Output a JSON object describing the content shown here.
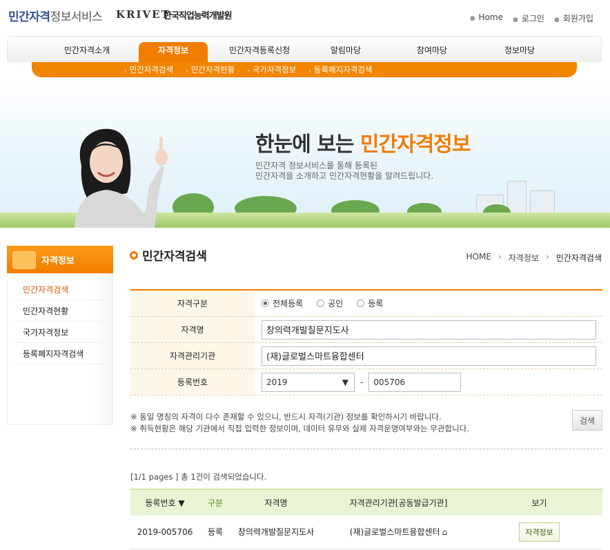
{
  "header": {
    "site_title_a": "민간자격",
    "site_title_b": "정보서비스",
    "org_logo": "KRIVET",
    "org_name": "한국직업능력개발원",
    "util_links": [
      "Home",
      "로그인",
      "회원가입"
    ]
  },
  "gnb": {
    "items": [
      "민간자격소개",
      "자격정보",
      "민간자격등록신청",
      "알림마당",
      "참여마당",
      "정보마당"
    ],
    "active_index": 1
  },
  "lnb": {
    "items": [
      "민간자격검색",
      "민간자격현황",
      "국가자격정보",
      "등록폐지자격검색"
    ]
  },
  "banner": {
    "title_plain": "한눈에 보는",
    "title_highlight": "민간자격정보",
    "desc_line1": "민간자격 정보서비스를 통해 등록된",
    "desc_line2": "민간자격을 소개하고 민간자격현황을 알려드립니다."
  },
  "sidebar": {
    "title": "자격정보",
    "items": [
      "민간자격검색",
      "민간자격현황",
      "국가자격정보",
      "등록폐지자격검색"
    ],
    "active_index": 0
  },
  "page": {
    "title": "민간자격검색",
    "breadcrumb": [
      "HOME",
      "자격정보",
      "민간자격검색"
    ]
  },
  "form": {
    "type_label": "자격구분",
    "type_options": [
      "전체등록",
      "공인",
      "등록"
    ],
    "type_selected": "전체등록",
    "name_label": "자격명",
    "name_value": "창의력개발질문지도사",
    "org_label": "자격관리기관",
    "org_value": "(재)글로벌스마트융합센터",
    "reg_label": "등록번호",
    "reg_year": "2019",
    "reg_sep": "-",
    "reg_number": "005706",
    "note1": "※ 동일 명칭의 자격이 다수 존재할 수 있으니, 반드시 자격(기관) 정보를 확인하시기 바랍니다.",
    "note2": "※ 취득현황은 해당 기관에서 직접 입력한 정보이며, 데이터 유무와 실제 자격운영여부와는 무관합니다.",
    "search_button": "검색"
  },
  "results": {
    "info": "[1/1 pages ] 총 1건이 검색되었습니다.",
    "columns": [
      "등록번호 ▼",
      "구분",
      "자격명",
      "자격관리기관[공동발급기관]",
      "보기"
    ],
    "rows": [
      {
        "reg_no": "2019-005706",
        "type": "등록",
        "name": "창의력개발질문지도사",
        "org": "(재)글로벌스마트융합센터",
        "view_label": "자격정보"
      }
    ]
  },
  "colors": {
    "accent": "#f07c00",
    "table_header": "#e8f4d4",
    "brand_blue": "#2f4f8f"
  }
}
